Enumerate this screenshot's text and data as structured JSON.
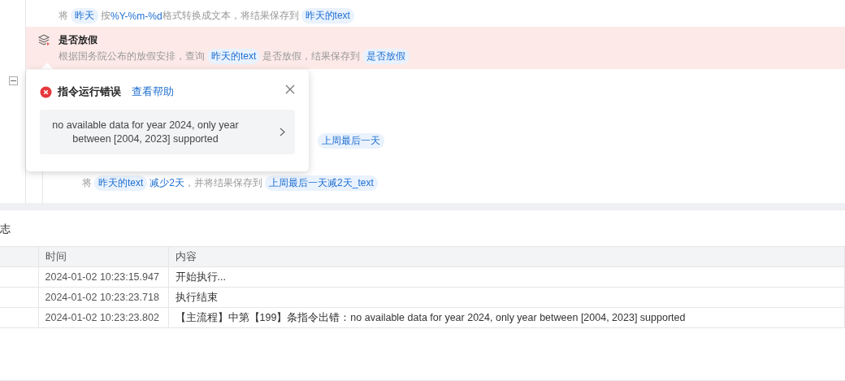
{
  "flow_steps": [
    {
      "highlighted": false,
      "description": [
        {
          "kind": "text",
          "text": "将"
        },
        {
          "kind": "var",
          "text": "昨天"
        },
        {
          "kind": "text",
          "text": "按"
        },
        {
          "kind": "param",
          "text": "%Y-%m-%d"
        },
        {
          "kind": "text",
          "text": "格式转换成文本，将结果保存到"
        },
        {
          "kind": "var",
          "text": "昨天的text"
        }
      ]
    },
    {
      "highlighted": true,
      "title": "是否放假",
      "description": [
        {
          "kind": "text",
          "text": "根据国务院公布的放假安排，查询"
        },
        {
          "kind": "var",
          "text": "昨天的text"
        },
        {
          "kind": "text",
          "text": "是否放假，结果保存到"
        },
        {
          "kind": "var",
          "text": "是否放假"
        }
      ]
    }
  ],
  "group_toggle": {
    "expanded": true
  },
  "hidden_steps": [
    {
      "description": [
        {
          "kind": "var",
          "text": "上周最后一天"
        }
      ]
    },
    {
      "description": [
        {
          "kind": "text",
          "text": "将"
        },
        {
          "kind": "var",
          "text": "昨天的text"
        },
        {
          "kind": "param",
          "text": "减少2天"
        },
        {
          "kind": "text",
          "text": "，并将结果保存到"
        },
        {
          "kind": "var",
          "text": "上周最后一天减2天_text"
        }
      ]
    }
  ],
  "error_popover": {
    "title": "指令运行错误",
    "help_link": "查看帮助",
    "message": "no available data for year 2024, only year between [2004, 2023] supported"
  },
  "log": {
    "title": "志",
    "columns": [
      "时间",
      "内容"
    ],
    "rows": [
      {
        "time": "2024-01-02 10:23:15.947",
        "content": "开始执行..."
      },
      {
        "time": "2024-01-02 10:23:23.718",
        "content": "执行结束"
      },
      {
        "time": "2024-01-02 10:23:23.802",
        "content": "【主流程】中第【199】条指令出错：no available data for year 2024, only year between [2004, 2023] supported"
      }
    ]
  }
}
